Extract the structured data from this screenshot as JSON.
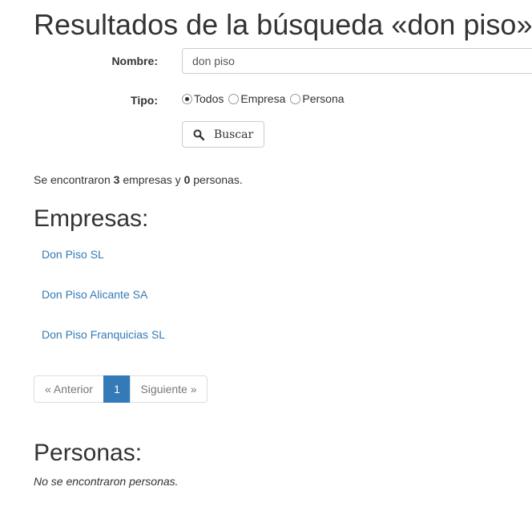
{
  "page": {
    "title": "Resultados de la búsqueda «don piso»"
  },
  "form": {
    "name_label": "Nombre:",
    "name_value": "don piso",
    "type_label": "Tipo:",
    "type_options": [
      {
        "label": "Todos",
        "checked": true
      },
      {
        "label": "Empresa",
        "checked": false
      },
      {
        "label": "Persona",
        "checked": false
      }
    ],
    "search_button_label": "Buscar",
    "search_icon": "search-icon"
  },
  "summary": {
    "prefix": "Se encontraron",
    "companies_count": "3",
    "middle": "empresas y",
    "persons_count": "0",
    "suffix": "personas."
  },
  "companies": {
    "heading": "Empresas:",
    "items": [
      {
        "label": "Don Piso SL"
      },
      {
        "label": "Don Piso Alicante SA"
      },
      {
        "label": "Don Piso Franquicias SL"
      }
    ]
  },
  "pagination": {
    "prev_label": "« Anterior",
    "current_page": "1",
    "next_label": "Siguiente »",
    "active_color": "#337ab7"
  },
  "persons": {
    "heading": "Personas:",
    "empty_message": "No se encontraron personas."
  },
  "colors": {
    "link": "#337ab7",
    "text": "#333333"
  }
}
